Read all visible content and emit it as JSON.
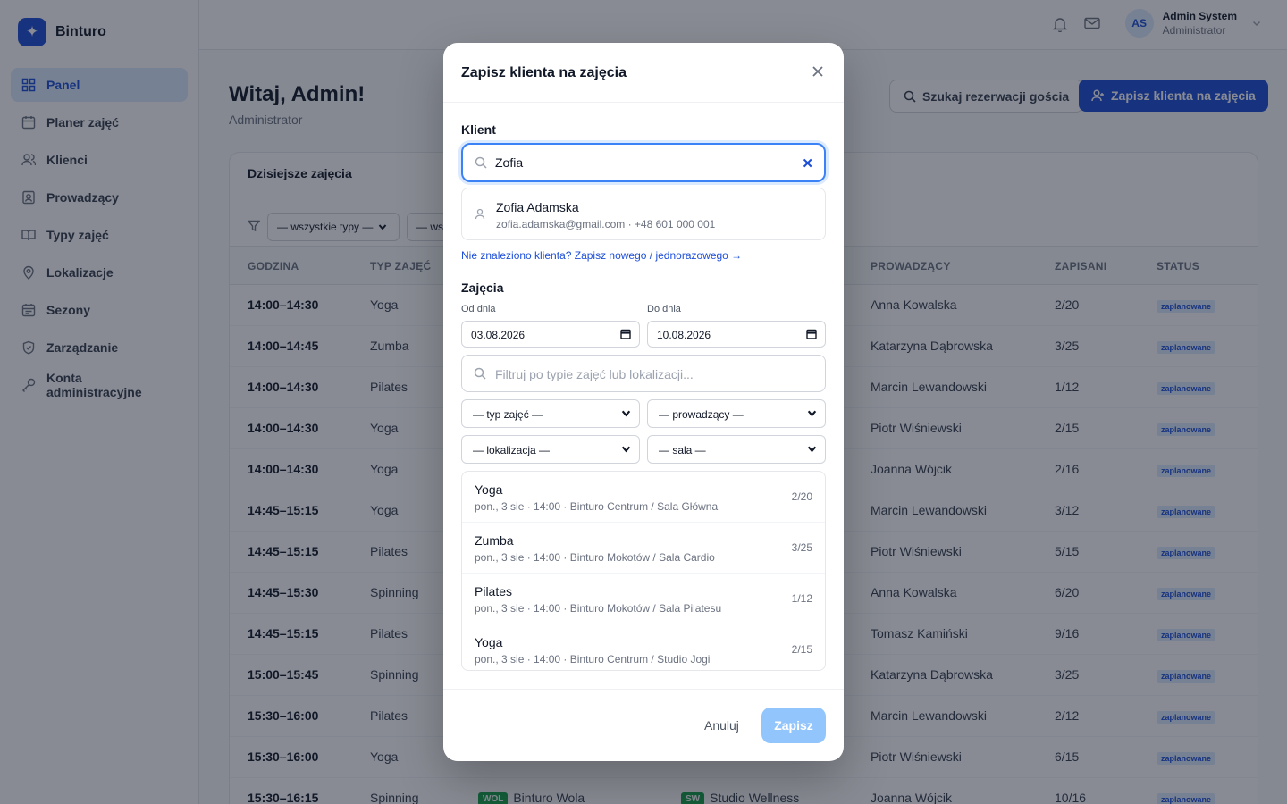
{
  "brand": {
    "name": "Binturo",
    "logo_icon": "sparkle-icon"
  },
  "colors": {
    "accent": "#1d4ed8",
    "active_nav_bg": "#dbeafe",
    "success": "#16a34a"
  },
  "sidebar": {
    "items": [
      {
        "label": "Panel",
        "icon": "grid-icon",
        "active": true
      },
      {
        "label": "Planer zajęć",
        "icon": "calendar-icon"
      },
      {
        "label": "Klienci",
        "icon": "users-icon"
      },
      {
        "label": "Prowadzący",
        "icon": "id-badge-icon"
      },
      {
        "label": "Typy zajęć",
        "icon": "book-icon"
      },
      {
        "label": "Lokalizacje",
        "icon": "map-pin-icon"
      },
      {
        "label": "Sezony",
        "icon": "calendar-range-icon"
      },
      {
        "label": "Zarządzanie",
        "icon": "shield-icon"
      },
      {
        "label": "Konta administracyjne",
        "icon": "key-icon"
      }
    ]
  },
  "topbar": {
    "user": {
      "initials": "AS",
      "name": "Admin System",
      "role": "Administrator"
    }
  },
  "header": {
    "title": "Witaj, Admin!",
    "subtitle": "Administrator",
    "search_button": "Szukaj rezerwacji gościa",
    "enroll_button": "Zapisz klienta na zajęcia"
  },
  "today": {
    "title": "Dzisiejsze zajęcia",
    "filter_type": "— wszystkie typy —",
    "filter_partial": "— ws",
    "columns": {
      "time": "GODZINA",
      "type": "TYP ZAJĘĆ",
      "instructor": "PROWADZĄCY",
      "enrolled": "ZAPISANI",
      "status": "STATUS"
    },
    "rows": [
      {
        "time": "14:00–14:30",
        "type": "Yoga",
        "instructor": "Anna Kowalska",
        "enrolled": "2/20",
        "status": "zaplanowane"
      },
      {
        "time": "14:00–14:45",
        "type": "Zumba",
        "instructor": "Katarzyna Dąbrowska",
        "enrolled": "3/25",
        "status": "zaplanowane"
      },
      {
        "time": "14:00–14:30",
        "type": "Pilates",
        "instructor": "Marcin Lewandowski",
        "enrolled": "1/12",
        "status": "zaplanowane"
      },
      {
        "time": "14:00–14:30",
        "type": "Yoga",
        "instructor": "Piotr Wiśniewski",
        "enrolled": "2/15",
        "status": "zaplanowane"
      },
      {
        "time": "14:00–14:30",
        "type": "Yoga",
        "instructor": "Joanna Wójcik",
        "enrolled": "2/16",
        "status": "zaplanowane"
      },
      {
        "time": "14:45–15:15",
        "type": "Yoga",
        "instructor": "Marcin Lewandowski",
        "enrolled": "3/12",
        "status": "zaplanowane"
      },
      {
        "time": "14:45–15:15",
        "type": "Pilates",
        "instructor": "Piotr Wiśniewski",
        "enrolled": "5/15",
        "status": "zaplanowane"
      },
      {
        "time": "14:45–15:30",
        "type": "Spinning",
        "instructor": "Anna Kowalska",
        "enrolled": "6/20",
        "status": "zaplanowane"
      },
      {
        "time": "14:45–15:15",
        "type": "Pilates",
        "instructor": "Tomasz Kamiński",
        "enrolled": "9/16",
        "status": "zaplanowane"
      },
      {
        "time": "15:00–15:45",
        "type": "Spinning",
        "instructor": "Katarzyna Dąbrowska",
        "enrolled": "3/25",
        "status": "zaplanowane"
      },
      {
        "time": "15:30–16:00",
        "type": "Pilates",
        "instructor": "Marcin Lewandowski",
        "enrolled": "2/12",
        "status": "zaplanowane"
      },
      {
        "time": "15:30–16:00",
        "type": "Yoga",
        "instructor": "Piotr Wiśniewski",
        "enrolled": "6/15",
        "status": "zaplanowane"
      },
      {
        "time": "15:30–16:15",
        "type": "Spinning",
        "location_tag": "WOL",
        "location": "Binturo Wola",
        "room_tag": "SW",
        "room": "Studio Wellness",
        "instructor": "Joanna Wójcik",
        "enrolled": "10/16",
        "status": "zaplanowane"
      }
    ]
  },
  "modal": {
    "title": "Zapisz klienta na zajęcia",
    "client_label": "Klient",
    "search_value": "Zofia",
    "suggestion": {
      "name": "Zofia Adamska",
      "meta": "zofia.adamska@gmail.com · +48 601 000 001"
    },
    "not_found_link": "Nie znaleziono klienta? Zapisz nowego / jednorazowego →",
    "classes_label": "Zajęcia",
    "from_label": "Od dnia",
    "from_value": "03.08.2026",
    "to_label": "Do dnia",
    "to_value": "10.08.2026",
    "filter_placeholder": "Filtruj po typie zajęć lub lokalizacji...",
    "select_type": "— typ zajęć —",
    "select_instructor": "— prowadzący —",
    "select_location": "— lokalizacja —",
    "select_room": "— sala —",
    "classes": [
      {
        "name": "Yoga",
        "details": "pon., 3 sie · 14:00 · Binturo Centrum / Sala Główna",
        "count": "2/20"
      },
      {
        "name": "Zumba",
        "details": "pon., 3 sie · 14:00 · Binturo Mokotów / Sala Cardio",
        "count": "3/25"
      },
      {
        "name": "Pilates",
        "details": "pon., 3 sie · 14:00 · Binturo Mokotów / Sala Pilatesu",
        "count": "1/12"
      },
      {
        "name": "Yoga",
        "details": "pon., 3 sie · 14:00 · Binturo Centrum / Studio Jogi",
        "count": "2/15"
      }
    ],
    "cancel": "Anuluj",
    "save": "Zapisz"
  }
}
